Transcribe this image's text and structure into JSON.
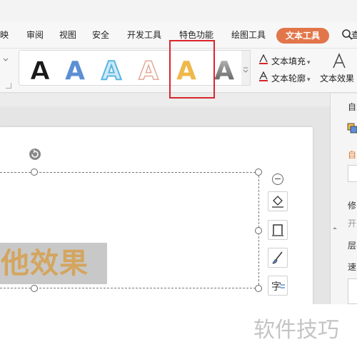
{
  "menu": {
    "items": [
      "放映",
      "审阅",
      "视图",
      "安全",
      "开发工具",
      "特色功能",
      "绘图工具"
    ],
    "active": "文本工具",
    "search_label": "查"
  },
  "ribbon": {
    "gallery": [
      {
        "letter": "A",
        "fill": "#1a1a1a",
        "stroke": "#ffffff",
        "style": "bold-black"
      },
      {
        "letter": "A",
        "fill": "#5b8fd6",
        "stroke": "#ffffff",
        "style": "bold-blue"
      },
      {
        "letter": "A",
        "fill": "#cfe9f7",
        "stroke": "#59b7e2",
        "style": "outline-blue"
      },
      {
        "letter": "A",
        "fill": "#ffffff",
        "stroke": "#e4a99a",
        "style": "outline-rose"
      },
      {
        "letter": "A",
        "fill": "#f0b84a",
        "stroke": "#ffffff",
        "style": "bold-gold"
      },
      {
        "letter": "A",
        "fill": "#8a8a8a",
        "stroke": "#ffffff",
        "style": "gradient-gray"
      }
    ],
    "text_fill": "文本填充",
    "text_outline": "文本轮廓",
    "text_effect": "文本效果",
    "highlight_color": "#d9262b"
  },
  "canvas": {
    "text": "他效果",
    "text_color": "#d4a55e"
  },
  "right_panel": {
    "title": "自定",
    "section": "自",
    "label_1": "修",
    "label_2": "开",
    "label_3": "层",
    "label_4": "速"
  },
  "watermark": "软件技巧"
}
